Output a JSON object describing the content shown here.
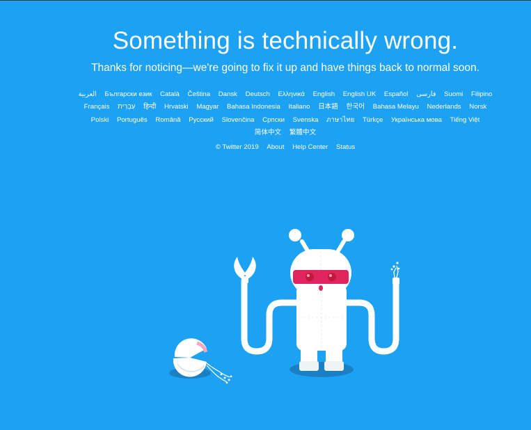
{
  "header": {
    "title": "Something is technically wrong.",
    "subtitle": "Thanks for noticing—we're going to fix it up and have things back to normal soon."
  },
  "languages": [
    "العربية",
    "Български език",
    "Català",
    "Čeština",
    "Dansk",
    "Deutsch",
    "Ελληνικά",
    "English",
    "English UK",
    "Español",
    "فارسی",
    "Suomi",
    "Filipino",
    "Français",
    "עִבְרִית",
    "हिन्दी",
    "Hrvatski",
    "Magyar",
    "Bahasa Indonesia",
    "Italiano",
    "日本語",
    "한국어",
    "Bahasa Melayu",
    "Nederlands",
    "Norsk",
    "Polski",
    "Português",
    "Română",
    "Русский",
    "Slovenčina",
    "Српски",
    "Svenska",
    "ภาษาไทย",
    "Türkçe",
    "Українська мова",
    "Tiếng Việt",
    "简体中文",
    "繁體中文"
  ],
  "footer": {
    "copyright": "© Twitter 2019",
    "about": "About",
    "help_center": "Help Center",
    "status": "Status"
  },
  "colors": {
    "background": "#1da1f2",
    "robot_body": "#ffffff",
    "robot_shadow": "#1b7fc4",
    "visor": "#e0245e",
    "eyes": "#e0245e"
  },
  "illustration": {
    "icon": "broken-robot-illustration"
  }
}
